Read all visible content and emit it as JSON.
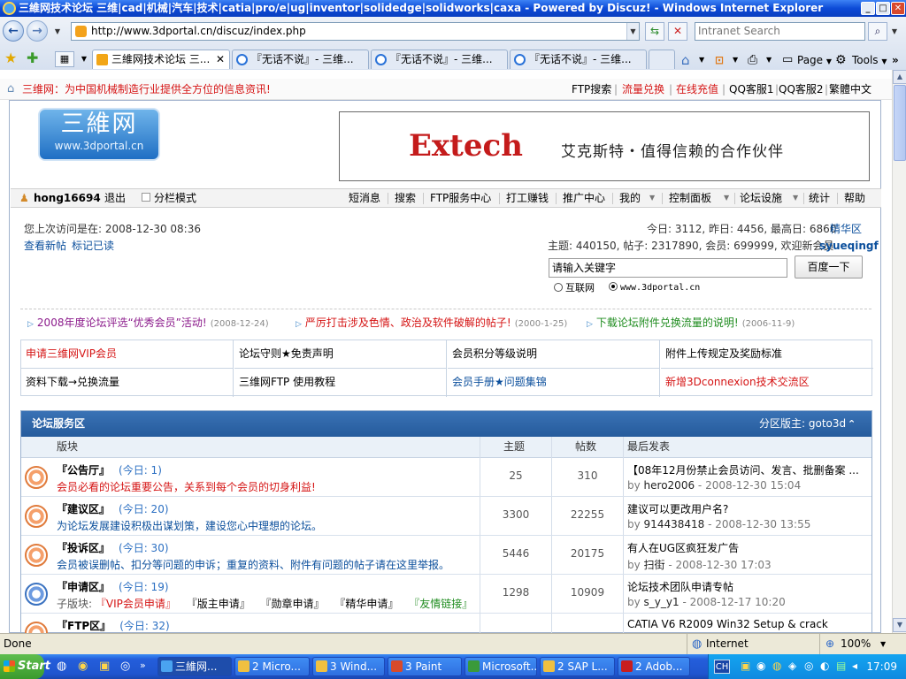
{
  "window": {
    "title": "三維网技术论坛 三维|cad|机械|汽车|技术|catia|pro/e|ug|inventor|solidedge|solidworks|caxa - Powered by Discuz! - Windows Internet Explorer"
  },
  "browser": {
    "url": "http://www.3dportal.cn/discuz/index.php",
    "search_placeholder": "Intranet Search",
    "tabs": [
      {
        "label": "三維网技术论坛 三..."
      },
      {
        "label": "『无话不说』- 三维..."
      },
      {
        "label": "『无话不说』- 三维..."
      },
      {
        "label": "『无话不说』- 三维..."
      }
    ],
    "cmd_page": "Page",
    "cmd_tools": "Tools"
  },
  "topbar": {
    "slogan": "三维网：为中国机械制造行业提供全方位的信息资讯!",
    "links": [
      "FTP搜索",
      "流量兑换",
      "在线充值",
      "QQ客服1",
      "QQ客服2",
      "繁體中文"
    ]
  },
  "header": {
    "logo_text": "三維网",
    "logo_url": "www.3dportal.cn",
    "banner_brand": "Extech",
    "banner_text": "艾克斯特・值得信赖的合作伙伴"
  },
  "nav": {
    "username": "hong16694",
    "logout": "退出",
    "column_mode": "分栏模式",
    "items": [
      "短消息",
      "搜索",
      "FTP服务中心",
      "打工赚钱",
      "推广中心",
      "我的",
      "控制面板",
      "论坛设施",
      "统计",
      "帮助"
    ]
  },
  "info": {
    "last_visit": "您上次访问是在: 2008-12-30 08:36",
    "new_posts": "查看新帖",
    "mark_read": "标记已读",
    "stats_line": "今日: 3112, 昨日: 4456, 最高日: 6860",
    "elite": "精华区",
    "counts_line": "主题: 440150, 帖子: 2317890, 会员: 699999, 欢迎新会员",
    "new_member": "syueqingf",
    "keyword_placeholder": "请输入关键字",
    "baidu_button": "百度一下",
    "radio_web": "互联网",
    "radio_site": "www.3dportal.cn"
  },
  "announcements": [
    {
      "text": "2008年度论坛评选“优秀会员”活动!",
      "date": "(2008-12-24)",
      "color": "#8b1a8b"
    },
    {
      "text": "严厉打击涉及色情、政治及软件破解的帖子!",
      "date": "(2000-1-25)",
      "color": "#d51414"
    },
    {
      "text": "下载论坛附件兑换流量的说明!",
      "date": "(2006-11-9)",
      "color": "#1f8c1f"
    }
  ],
  "link_grid": [
    {
      "text": "申请三维网VIP会员",
      "color": "#d51414"
    },
    {
      "text": "论坛守则★免责声明",
      "color": "#000000"
    },
    {
      "text": "会员积分等级说明",
      "color": "#000000"
    },
    {
      "text": "附件上传规定及奖励标准",
      "color": "#000000"
    },
    {
      "text": "资料下载→兑换流量",
      "color": "#000000"
    },
    {
      "text": "三维网FTP 使用教程",
      "color": "#000000"
    },
    {
      "text": "会员手册★问题集锦",
      "color": "#0b4f9c"
    },
    {
      "text": "新增3Dconnexion技术交流区",
      "color": "#d51414"
    }
  ],
  "forum_section": {
    "title": "论坛服务区",
    "moderator": "分区版主: goto3d",
    "columns": {
      "board": "版块",
      "topics": "主题",
      "posts": "帖数",
      "last": "最后发表"
    },
    "rows": [
      {
        "name": "『公告厅』",
        "today": "(今日: 1)",
        "desc": "会员必看的论坛重要公告，关系到每个会员的切身利益!",
        "desc_color": "#d51414",
        "topics": "25",
        "posts": "310",
        "last_title": "【08年12月份禁止会员访问、发言、批删备案 ...",
        "last_by": "by",
        "last_user": "hero2006",
        "last_time": "- 2008-12-30 15:04",
        "icon": "orange"
      },
      {
        "name": "『建议区』",
        "today": "(今日: 20)",
        "desc": "为论坛发展建设积极出谋划策，建设您心中理想的论坛。",
        "desc_color": "#0b4f9c",
        "topics": "3300",
        "posts": "22255",
        "last_title": "建议可以更改用户名?",
        "last_by": "by",
        "last_user": "914438418",
        "last_time": "- 2008-12-30 13:55",
        "icon": "orange"
      },
      {
        "name": "『投诉区』",
        "today": "(今日: 30)",
        "desc": "会员被误删帖、扣分等问题的申诉；重复的资料、附件有问题的帖子请在这里举报。",
        "desc_color": "#0b4f9c",
        "topics": "5446",
        "posts": "20175",
        "last_title": "有人在UG区疯狂发广告",
        "last_by": "by",
        "last_user": "扫街",
        "last_time": "- 2008-12-30 17:03",
        "icon": "orange"
      },
      {
        "name": "『申请区』",
        "today": "(今日: 19)",
        "desc_prefix": "子版块:",
        "subforums": [
          {
            "text": "『VIP会员申请』",
            "color": "#d51414"
          },
          {
            "text": "『版主申请』",
            "color": "#000000"
          },
          {
            "text": "『勋章申请』",
            "color": "#000000"
          },
          {
            "text": "『精华申请』",
            "color": "#000000"
          },
          {
            "text": "『友情链接』",
            "color": "#1f8c1f"
          }
        ],
        "topics": "1298",
        "posts": "10909",
        "last_title": "论坛技术团队申请专帖",
        "last_by": "by",
        "last_user": "s_y_y1",
        "last_time": "- 2008-12-17 10:20",
        "icon": "blue"
      },
      {
        "name": "『FTP区』",
        "today": "(今日: 32)",
        "desc": "",
        "desc_color": "#0b4f9c",
        "topics": "",
        "posts": "",
        "last_title": "CATIA V6 R2009 Win32 Setup & crack",
        "last_by": "",
        "last_user": "",
        "last_time": "",
        "icon": "orange"
      }
    ]
  },
  "status": {
    "left": "Done",
    "zone": "Internet",
    "zoom": "100%"
  },
  "taskbar": {
    "start": "Start",
    "tasks": [
      "三維网...",
      "2 Micro...",
      "3 Wind...",
      "3 Paint",
      "Microsoft...",
      "2 SAP L...",
      "2 Adob..."
    ],
    "lang": "CH",
    "clock": "17:09"
  }
}
